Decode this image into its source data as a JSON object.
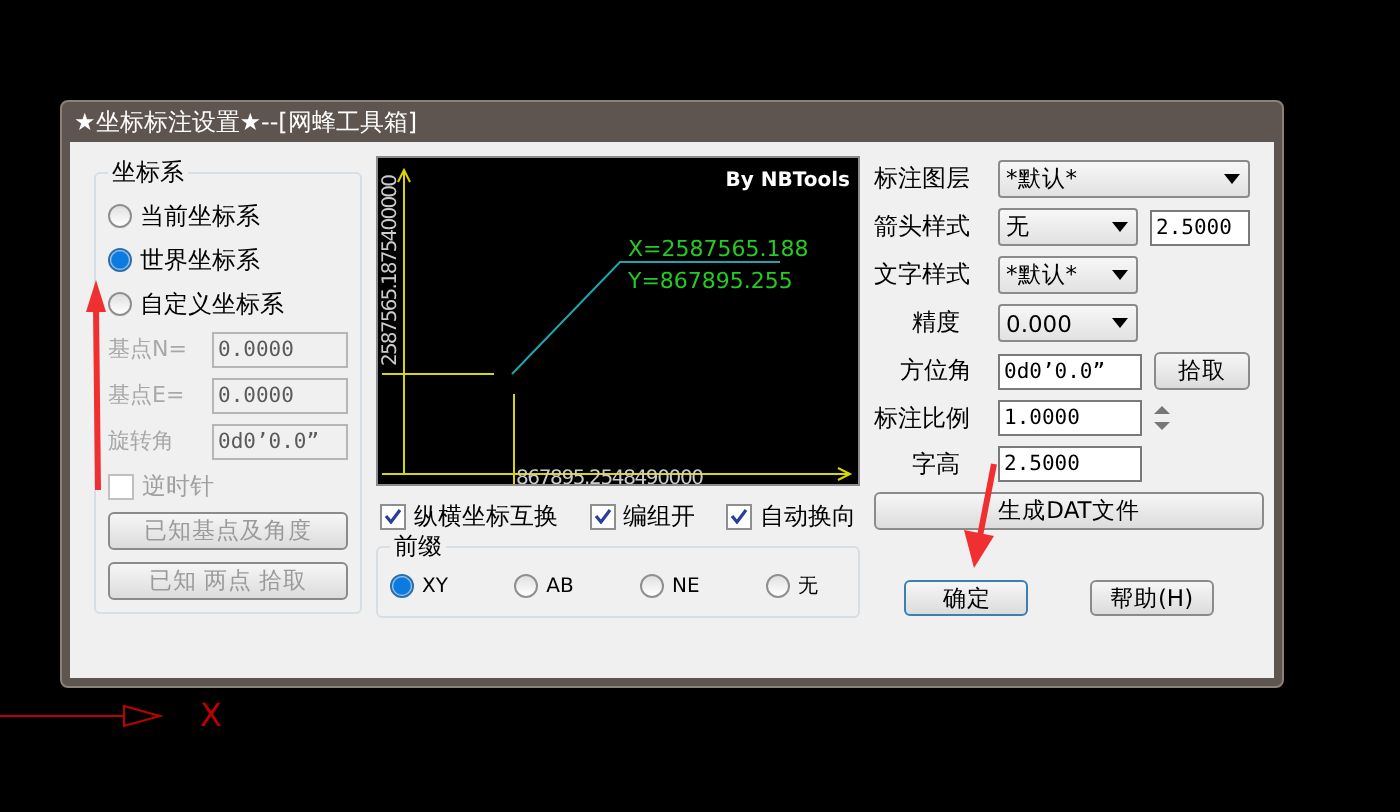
{
  "window": {
    "title": "★坐标标注设置★--[网蜂工具箱]"
  },
  "coordinate_system": {
    "label": "坐标系",
    "options": [
      {
        "label": "当前坐标系",
        "selected": false
      },
      {
        "label": "世界坐标系",
        "selected": true
      },
      {
        "label": "自定义坐标系",
        "selected": false
      }
    ],
    "fields": [
      {
        "label": "基点N=",
        "value": "0.0000",
        "disabled": true
      },
      {
        "label": "基点E=",
        "value": "0.0000",
        "disabled": true
      },
      {
        "label": "旋转角",
        "value": "0d0’0.0”",
        "disabled": true
      }
    ],
    "counterclockwise": {
      "label": "逆时针",
      "checked": false,
      "disabled": true
    },
    "buttons": [
      {
        "label": "已知基点及角度",
        "disabled": true
      },
      {
        "label": "已知 两点 拾取",
        "disabled": true
      }
    ]
  },
  "preview": {
    "credit": "By NBTools",
    "x_reading": "X=2587565.188",
    "y_reading": "Y=867895.255",
    "vertical_axis_label": "2587565.1875400000",
    "horizontal_axis_label": "867895.2548490000"
  },
  "options": [
    {
      "label": "纵横坐标互换",
      "checked": true
    },
    {
      "label": "编组开",
      "checked": true
    },
    {
      "label": "自动换向",
      "checked": true
    }
  ],
  "prefix": {
    "label": "前缀",
    "options": [
      {
        "label": "XY",
        "selected": true
      },
      {
        "label": "AB",
        "selected": false
      },
      {
        "label": "NE",
        "selected": false
      },
      {
        "label": "无",
        "selected": false
      }
    ]
  },
  "settings": [
    {
      "kind": "select",
      "label": "标注图层",
      "value": "*默认*",
      "wide": true
    },
    {
      "kind": "select_input",
      "label": "箭头样式",
      "value": "无",
      "extra": "2.5000"
    },
    {
      "kind": "select",
      "label": "文字样式",
      "value": "*默认*"
    },
    {
      "kind": "select",
      "label": "精度",
      "value": "0.000"
    },
    {
      "kind": "input_button",
      "label": "方位角",
      "value": "0d0’0.0”",
      "button": "拾取"
    },
    {
      "kind": "spinner",
      "label": "标注比例",
      "value": "1.0000"
    },
    {
      "kind": "input",
      "label": "字高",
      "value": "2.5000"
    }
  ],
  "generate_button": "生成DAT文件",
  "footer_buttons": [
    {
      "label": "确定",
      "default": true
    },
    {
      "label": "帮助(H)",
      "default": false
    }
  ],
  "canvas": {
    "axis_label": "X"
  }
}
